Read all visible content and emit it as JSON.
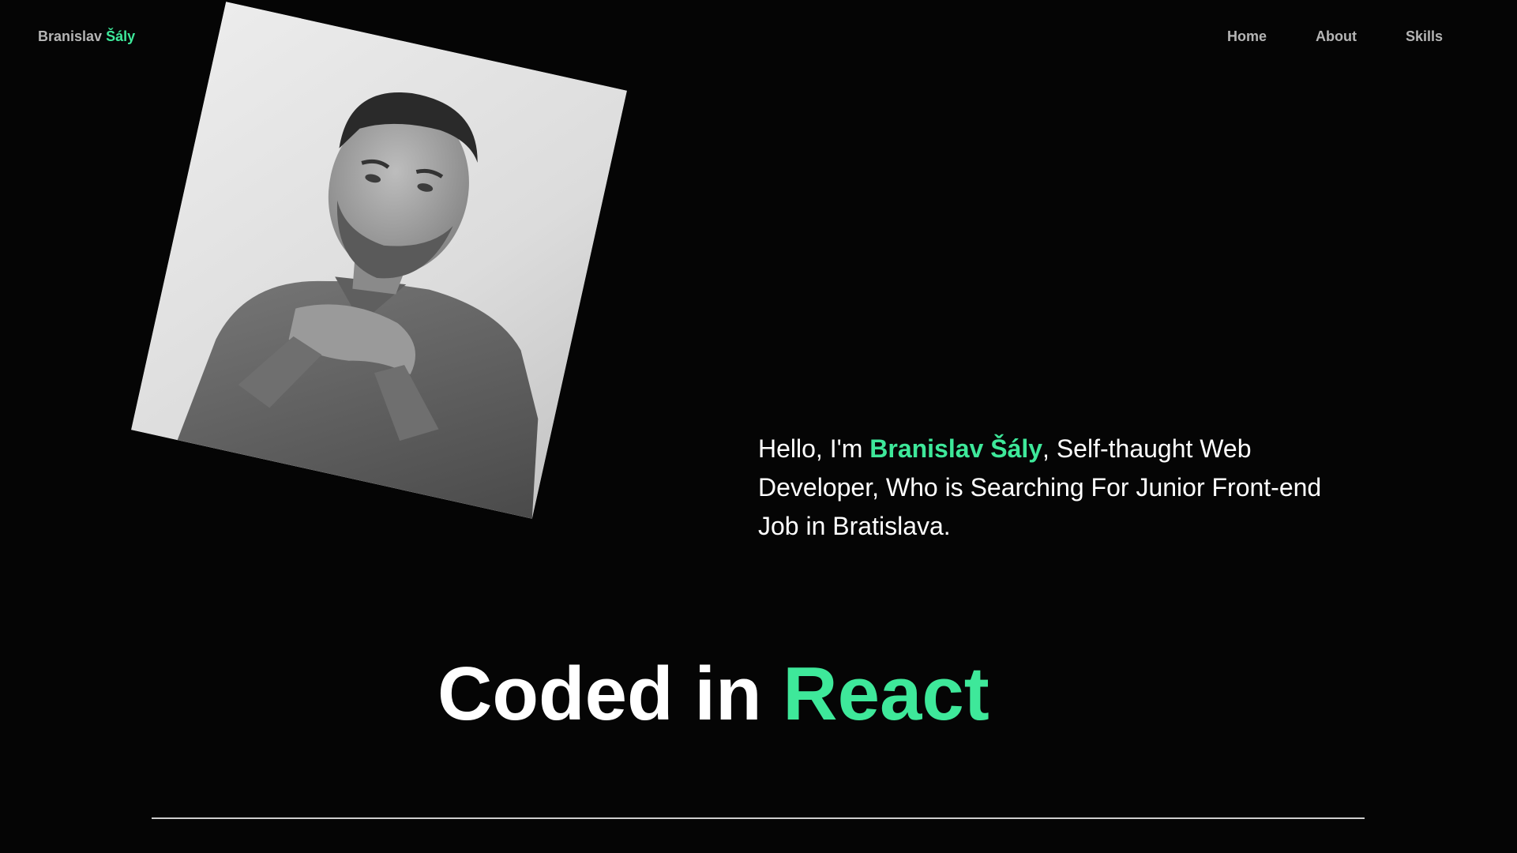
{
  "brand": {
    "first_name": "Branislav",
    "last_name": "Šály"
  },
  "nav": {
    "items": [
      {
        "label": "Home"
      },
      {
        "label": "About"
      },
      {
        "label": "Skills"
      }
    ]
  },
  "hero": {
    "intro_prefix": "Hello, I'm ",
    "intro_name": "Branislav Šály",
    "intro_suffix": ", Self-thaught Web Developer, Who is Searching For Junior Front-end Job in Bratislava.",
    "coded_prefix": "Coded in ",
    "coded_tech": "React"
  },
  "colors": {
    "accent": "#3ee89a",
    "background": "#050505",
    "nav_text": "#b5b5b5",
    "text": "#ffffff"
  }
}
